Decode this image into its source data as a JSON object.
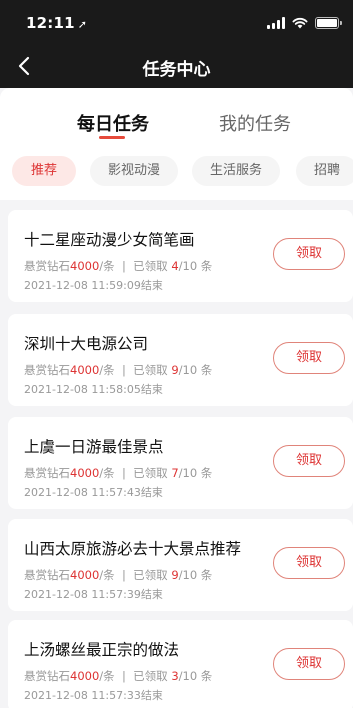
{
  "status": {
    "time": "12:11",
    "location_arrow": "➚"
  },
  "nav": {
    "title": "任务中心"
  },
  "main_tabs": [
    {
      "label": "每日任务",
      "active": true
    },
    {
      "label": "我的任务",
      "active": false
    }
  ],
  "chips": [
    {
      "label": "推荐",
      "active": true
    },
    {
      "label": "影视动漫",
      "active": false
    },
    {
      "label": "生活服务",
      "active": false
    },
    {
      "label": "招聘",
      "active": false
    }
  ],
  "tasks": [
    {
      "title": "十二星座动漫少女简笔画",
      "reward_prefix": "悬赏钻石",
      "reward_amount": "4000",
      "reward_unit": "/条",
      "claimed_prefix": "已领取 ",
      "claimed": "4",
      "total": "/10 条",
      "time": "2021-12-08 11:59:09结束",
      "button": "领取"
    },
    {
      "title": "深圳十大电源公司",
      "reward_prefix": "悬赏钻石",
      "reward_amount": "4000",
      "reward_unit": "/条",
      "claimed_prefix": "已领取 ",
      "claimed": "9",
      "total": "/10 条",
      "time": "2021-12-08 11:58:05结束",
      "button": "领取"
    },
    {
      "title": "上虞一日游最佳景点",
      "reward_prefix": "悬赏钻石",
      "reward_amount": "4000",
      "reward_unit": "/条",
      "claimed_prefix": "已领取 ",
      "claimed": "7",
      "total": "/10 条",
      "time": "2021-12-08 11:57:43结束",
      "button": "领取"
    },
    {
      "title": "山西太原旅游必去十大景点推荐",
      "reward_prefix": "悬赏钻石",
      "reward_amount": "4000",
      "reward_unit": "/条",
      "claimed_prefix": "已领取 ",
      "claimed": "9",
      "total": "/10 条",
      "time": "2021-12-08 11:57:39结束",
      "button": "领取"
    },
    {
      "title": "上汤螺丝最正宗的做法",
      "reward_prefix": "悬赏钻石",
      "reward_amount": "4000",
      "reward_unit": "/条",
      "claimed_prefix": "已领取 ",
      "claimed": "3",
      "total": "/10 条",
      "time": "2021-12-08 11:57:33结束",
      "button": "领取"
    }
  ],
  "colors": {
    "accent": "#d33333",
    "header_bg": "#1a1a1a",
    "page_bg": "#f4f4f6"
  }
}
